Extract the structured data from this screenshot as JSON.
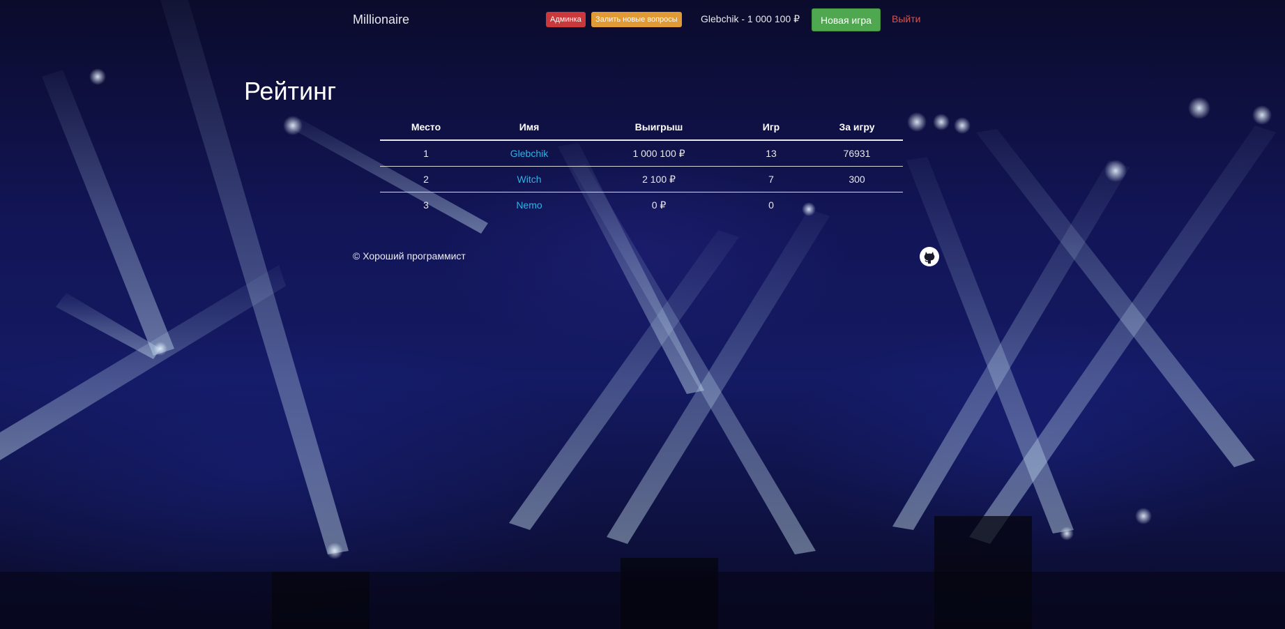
{
  "navbar": {
    "brand": "Millionaire",
    "admin_badge": "Админка",
    "upload_badge": "Залить новые вопросы",
    "user_info": "Glebchik - 1 000 100 ₽",
    "new_game_label": "Новая игра",
    "logout_label": "Выйти"
  },
  "page": {
    "title": "Рейтинг"
  },
  "table": {
    "headers": [
      "Место",
      "Имя",
      "Выигрыш",
      "Игр",
      "За игру"
    ],
    "rows": [
      {
        "place": "1",
        "name": "Glebchik",
        "winnings": "1 000 100 ₽",
        "games": "13",
        "per_game": "76931"
      },
      {
        "place": "2",
        "name": "Witch",
        "winnings": "2 100 ₽",
        "games": "7",
        "per_game": "300"
      },
      {
        "place": "3",
        "name": "Nemo",
        "winnings": "0 ₽",
        "games": "0",
        "per_game": ""
      }
    ]
  },
  "footer": {
    "copyright": "© Хороший программист",
    "github_icon": "github-icon"
  },
  "colors": {
    "admin_badge": "#c9393b",
    "upload_badge": "#e09a36",
    "new_game_button": "#4fa84f",
    "logout_link": "#d9534f",
    "player_link": "#2fb3e6"
  }
}
